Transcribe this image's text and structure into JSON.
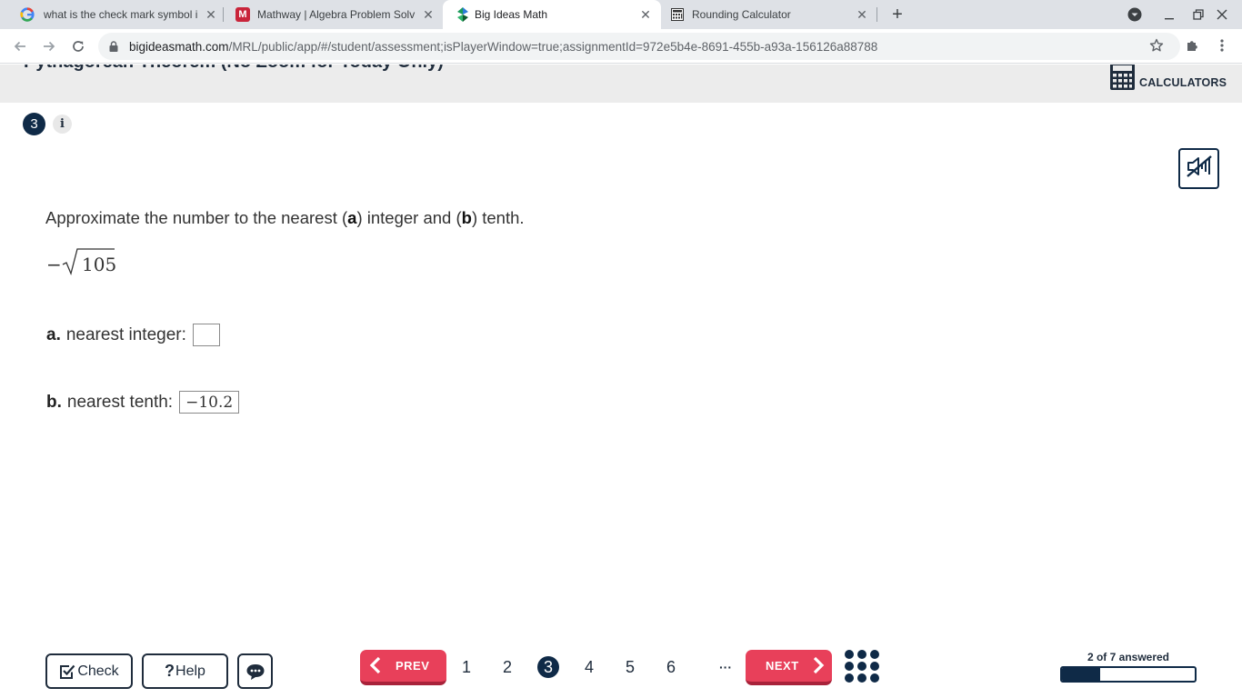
{
  "browser": {
    "tabs": [
      {
        "title": "what is the check mark symbol i",
        "favicon": "google-icon",
        "active": false
      },
      {
        "title": "Mathway | Algebra Problem Solv",
        "favicon": "mathway-icon",
        "active": false
      },
      {
        "title": "Big Ideas Math",
        "favicon": "big-ideas-math-icon",
        "active": true
      },
      {
        "title": "Rounding Calculator",
        "favicon": "calculator-grid-icon",
        "active": false
      }
    ],
    "url_host": "bigideasmath.com",
    "url_path": "/MRL/public/app/#/student/assessment;isPlayerWindow=true;assignmentId=972e5b4e-8691-455b-a93a-156126a88788"
  },
  "header": {
    "title": "Pythagorean Theorem (No Zoom for Today Only)",
    "calculators_label": "CALCULATORS"
  },
  "question": {
    "number": "3",
    "info_label": "i",
    "prompt_pre": "Approximate the number to the nearest (",
    "prompt_a": "a",
    "prompt_mid": ") integer and (",
    "prompt_b": "b",
    "prompt_post": ") tenth.",
    "expression_sign": "−",
    "expression_radicand": "105",
    "part_a": {
      "label": "a.",
      "text": "nearest integer:",
      "value": ""
    },
    "part_b": {
      "label": "b.",
      "text": "nearest tenth:",
      "value": "−10.2"
    }
  },
  "footer": {
    "check_label": "Check",
    "help_label": "Help",
    "prev_label": "PREV",
    "next_label": "NEXT",
    "pages": [
      "1",
      "2",
      "3",
      "4",
      "5",
      "6"
    ],
    "current_page": "3",
    "ellipsis": "···",
    "answered_text": "2 of 7 answered",
    "answered_count": 2,
    "total_count": 7
  },
  "colors": {
    "navy": "#0f2a47",
    "accent_red": "#e8405a",
    "banner_gray": "#ececec"
  }
}
